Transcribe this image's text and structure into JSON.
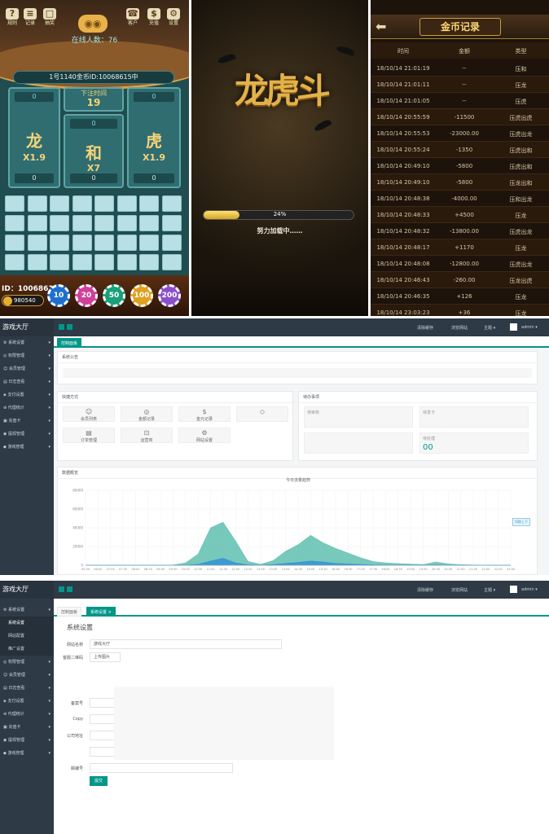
{
  "game": {
    "toolbar": [
      {
        "label": "规则",
        "glyph": "?"
      },
      {
        "label": "记录",
        "glyph": "≡"
      },
      {
        "label": "抽奖",
        "glyph": "□"
      },
      {
        "label": "客户",
        "glyph": "☎"
      },
      {
        "label": "充值",
        "glyph": "$"
      },
      {
        "label": "设置",
        "glyph": "⚙"
      }
    ],
    "online": "在线人数：76",
    "banker": "1号1140金币ID:10068615中",
    "countdown_label": "下注时间",
    "countdown": "19",
    "bets": [
      {
        "name": "龙",
        "odds": "X1.9",
        "top": "0",
        "bottom": "0"
      },
      {
        "name": "和",
        "odds": "X7",
        "top": "0",
        "bottom": "0"
      },
      {
        "name": "虎",
        "odds": "X1.9",
        "top": "0",
        "bottom": "0"
      }
    ],
    "player_id": "ID：10068615",
    "balance": "980540",
    "chips": [
      {
        "value": "10",
        "color": "#1e6fd0"
      },
      {
        "value": "20",
        "color": "#d0409a"
      },
      {
        "value": "50",
        "color": "#1aa07a"
      },
      {
        "value": "100",
        "color": "#e0a020"
      },
      {
        "value": "200",
        "color": "#8a50c8"
      }
    ]
  },
  "loading": {
    "logo": "龙虎斗",
    "progress_pct": 24,
    "progress_text": "24%",
    "message": "努力加载中……"
  },
  "records": {
    "title": "金币记录",
    "columns": [
      "时间",
      "金额",
      "类型"
    ],
    "rows": [
      [
        "18/10/14 21:01:19",
        "--",
        "压和"
      ],
      [
        "18/10/14 21:01:11",
        "--",
        "压龙"
      ],
      [
        "18/10/14 21:01:05",
        "--",
        "压虎"
      ],
      [
        "18/10/14 20:55:59",
        "-11500",
        "压虎出虎"
      ],
      [
        "18/10/14 20:55:53",
        "-23000.00",
        "压虎出龙"
      ],
      [
        "18/10/14 20:55:24",
        "-1350",
        "压虎出和"
      ],
      [
        "18/10/14 20:49:10",
        "-5800",
        "压虎出和"
      ],
      [
        "18/10/14 20:49:10",
        "-5800",
        "压龙出和"
      ],
      [
        "18/10/14 20:48:38",
        "-4000.00",
        "压和出龙"
      ],
      [
        "18/10/14 20:48:33",
        "+4500",
        "压龙"
      ],
      [
        "18/10/14 20:48:32",
        "-13800.00",
        "压虎出龙"
      ],
      [
        "18/10/14 20:48:17",
        "+1170",
        "压龙"
      ],
      [
        "18/10/14 20:48:08",
        "-12800.00",
        "压虎出龙"
      ],
      [
        "18/10/14 20:46:43",
        "-260.00",
        "压龙出虎"
      ],
      [
        "18/10/14 20:46:35",
        "+126",
        "压龙"
      ],
      [
        "18/10/14 23:03:23",
        "+36",
        "压龙"
      ]
    ]
  },
  "admin1": {
    "brand": "游戏大厅",
    "menu": [
      "系统设置",
      "权限管理",
      "会员管理",
      "日志查看",
      "支付设置",
      "代理统计",
      "充值卡",
      "提现管理",
      "游戏管理"
    ],
    "top_links": [
      "清除缓存",
      "浏览网站",
      "主题 ▾",
      "admin ▾"
    ],
    "tab": "控制面板",
    "notice_title": "系统公告",
    "quick_title": "快捷方式",
    "quick": [
      {
        "label": "会员列表",
        "glyph": "☺"
      },
      {
        "label": "金额记录",
        "glyph": "◎"
      },
      {
        "label": "金元记录",
        "glyph": "$"
      },
      {
        "label": "",
        "glyph": "◇"
      },
      {
        "label": "订单管理",
        "glyph": "▤"
      },
      {
        "label": "运营商",
        "glyph": "⊡"
      },
      {
        "label": "网站设置",
        "glyph": "⚙"
      }
    ],
    "todo_title": "待办事项",
    "stats": [
      {
        "label": "待审核",
        "value": ""
      },
      {
        "label": "待发卡",
        "value": ""
      },
      {
        "label": "",
        "value": ""
      },
      {
        "label": "待处理",
        "value": "00"
      }
    ],
    "chart_title": "数据概览",
    "chart_caption": "今日流量趋势",
    "chart_badge": "切换上下"
  },
  "admin2": {
    "brand": "游戏大厅",
    "menu_top": "系统设置",
    "submenu": [
      "系统设置",
      "网站配置",
      "推广设置"
    ],
    "menu": [
      "权限管理",
      "会员管理",
      "日志查看",
      "支付设置",
      "代理统计",
      "充值卡",
      "提现管理",
      "游戏管理"
    ],
    "top_links": [
      "清除缓存",
      "浏览网站",
      "主题 ▾",
      "admin ▾"
    ],
    "tabs": [
      "控制面板",
      "系统设置 ×"
    ],
    "heading": "系统设置",
    "fields": [
      {
        "label": "网站名称",
        "value": "游戏大厅"
      },
      {
        "label": "客服二维码",
        "value": "上传图片"
      },
      {
        "label": "备案号",
        "value": ""
      },
      {
        "label": "Copy",
        "value": ""
      },
      {
        "label": "公司地址",
        "value": ""
      },
      {
        "label": "",
        "value": ""
      },
      {
        "label": "邮编号",
        "value": ""
      }
    ],
    "submit": "提交"
  },
  "chart_data": {
    "type": "area",
    "title": "今日流量趋势",
    "x": [
      "05:00",
      "06:00",
      "07:00",
      "07:30",
      "08:00",
      "08:30",
      "09:00",
      "09:30",
      "10:00",
      "10:30",
      "11:00",
      "11:30",
      "12:00",
      "12:30",
      "13:00",
      "13:30",
      "14:00",
      "14:30",
      "15:00",
      "15:30",
      "16:00",
      "16:30",
      "17:00",
      "17:30",
      "18:00",
      "18:30",
      "19:00",
      "19:30",
      "20:00",
      "20:30",
      "21:00",
      "21:30",
      "22:00",
      "22:30",
      "23:00"
    ],
    "series": [
      {
        "values": [
          0,
          0,
          0,
          0,
          0,
          0,
          0,
          300,
          2500,
          12000,
          40000,
          46000,
          26000,
          4000,
          1000,
          5000,
          15000,
          22000,
          32000,
          24000,
          18000,
          13000,
          8000,
          4000,
          2500,
          1800,
          1200,
          800,
          3500,
          1500,
          600,
          300,
          200,
          100,
          0
        ],
        "color": "#5fc0b0"
      },
      {
        "values": [
          0,
          0,
          0,
          0,
          0,
          0,
          0,
          0,
          200,
          1000,
          4500,
          7500,
          2500,
          500,
          200,
          800,
          2000,
          3000,
          4500,
          3500,
          2000,
          1500,
          900,
          400,
          300,
          200,
          100,
          100,
          400,
          200,
          100,
          0,
          0,
          0,
          0
        ],
        "color": "#2f8fd6"
      }
    ],
    "ylim": [
      0,
      80000
    ],
    "yticks": [
      "0",
      "20000",
      "40000",
      "60000",
      "80000"
    ]
  }
}
